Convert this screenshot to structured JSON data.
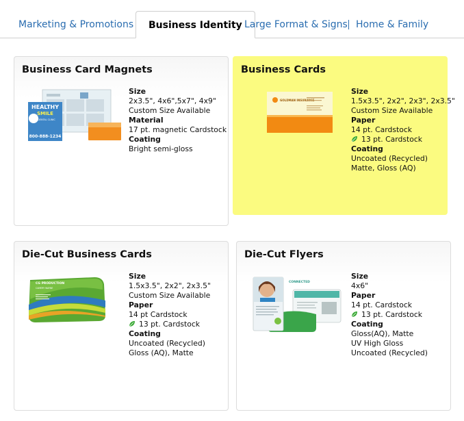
{
  "tabs": [
    {
      "label": "Marketing & Promotions"
    },
    {
      "label": "Business Identity"
    },
    {
      "label": "Large Format & Signs"
    },
    {
      "label": "Home & Family"
    }
  ],
  "active_tab": "Business Identity",
  "colors": {
    "link": "#2a6db0",
    "highlight": "#fbfb80",
    "eco_leaf": "#39a935"
  },
  "products": [
    {
      "title": "Business Card Magnets",
      "specs": [
        {
          "text": "Size",
          "head": true
        },
        {
          "text": "2x3.5\", 4x6\",5x7\", 4x9\""
        },
        {
          "text": "Custom Size Available"
        },
        {
          "text": "Material",
          "head": true
        },
        {
          "text": "17 pt. magnetic Cardstock"
        },
        {
          "text": "Coating",
          "head": true
        },
        {
          "text": "Bright semi-gloss"
        }
      ],
      "image_text": [
        "HEALTHY",
        "SMILE",
        "DENTAL CLINIC",
        "800-888-1234"
      ]
    },
    {
      "title": "Business Cards",
      "specs": [
        {
          "text": "Size",
          "head": true
        },
        {
          "text": "1.5x3.5\", 2x2\", 2x3\", 2x3.5\""
        },
        {
          "text": "Custom Size Available"
        },
        {
          "text": "Paper",
          "head": true
        },
        {
          "text": "14 pt. Cardstock"
        },
        {
          "text": "13 pt. Cardstock",
          "eco": true
        },
        {
          "text": "Coating",
          "head": true
        },
        {
          "text": "Uncoated (Recycled)"
        },
        {
          "text": "Matte, Gloss (AQ)"
        }
      ],
      "image_text": [
        "GOLDMAN INSURANCE"
      ]
    },
    {
      "title": "Die-Cut Business Cards",
      "specs": [
        {
          "text": "Size",
          "head": true
        },
        {
          "text": "1.5x3.5\", 2x2\", 2x3.5\""
        },
        {
          "text": "Custom Size Available"
        },
        {
          "text": "Paper",
          "head": true
        },
        {
          "text": "14 pt Cardstock"
        },
        {
          "text": "13 pt. Cardstock",
          "eco": true
        },
        {
          "text": "Coating",
          "head": true
        },
        {
          "text": "Uncoated (Recycled)"
        },
        {
          "text": "Gloss (AQ), Matte"
        }
      ],
      "image_text": [
        "CG PRODUCTION",
        "CAMERY WAYNE"
      ]
    },
    {
      "title": "Die-Cut Flyers",
      "specs": [
        {
          "text": "Size",
          "head": true
        },
        {
          "text": "4x6\""
        },
        {
          "text": "Paper",
          "head": true
        },
        {
          "text": "14 pt. Cardstock"
        },
        {
          "text": "13 pt. Cardstock",
          "eco": true
        },
        {
          "text": "Coating",
          "head": true
        },
        {
          "text": "Gloss(AQ), Matte"
        },
        {
          "text": "UV High Gloss"
        },
        {
          "text": "Uncoated (Recycled)"
        }
      ],
      "image_text": [
        "CONNECTED"
      ]
    }
  ]
}
